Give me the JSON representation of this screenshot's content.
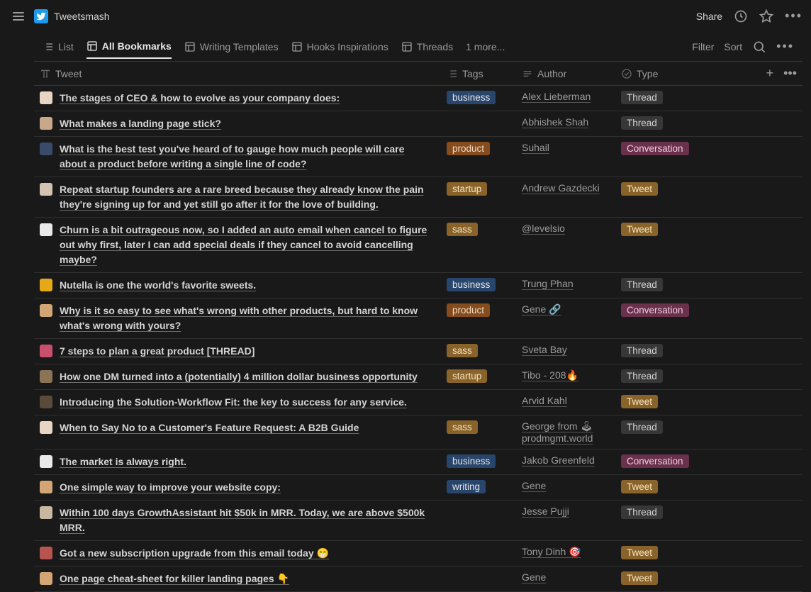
{
  "header": {
    "title": "Tweetsmash",
    "share": "Share"
  },
  "tabs": {
    "items": [
      {
        "icon": "list",
        "label": "List"
      },
      {
        "icon": "table",
        "label": "All Bookmarks",
        "active": true
      },
      {
        "icon": "table",
        "label": "Writing Templates"
      },
      {
        "icon": "table",
        "label": "Hooks Inspirations"
      },
      {
        "icon": "table",
        "label": "Threads"
      }
    ],
    "more": "1 more...",
    "filter": "Filter",
    "sort": "Sort"
  },
  "columns": {
    "tweet": "Tweet",
    "tags": "Tags",
    "author": "Author",
    "type": "Type"
  },
  "rows": [
    {
      "avatar": "#e8d5c4",
      "tweet": "The stages of CEO & how to evolve as your company does:",
      "tag": "business",
      "author": "Alex Lieberman",
      "type": "Thread"
    },
    {
      "avatar": "#c9a88a",
      "tweet": "What makes a landing page stick?",
      "tag": "",
      "author": "Abhishek Shah",
      "type": "Thread"
    },
    {
      "avatar": "#3a4a6b",
      "tweet": "What is the best test you've heard of to gauge how much people will care about a product before writing a single line of code?",
      "tag": "product",
      "author": "Suhail",
      "type": "Conversation"
    },
    {
      "avatar": "#d4c3b0",
      "tweet": "Repeat startup founders are a rare breed because they already know the pain they're signing up for and yet still go after it for the love of building.",
      "tag": "startup",
      "author": "Andrew Gazdecki",
      "type": "Tweet"
    },
    {
      "avatar": "#e8e8e8",
      "tweet": "Churn is a bit outrageous now, so I added an auto email when cancel to figure out why first, later I can add special deals if they cancel to avoid cancelling maybe?",
      "tag": "sass",
      "author": "@levelsio",
      "type": "Tweet"
    },
    {
      "avatar": "#e6a817",
      "tweet": "Nutella is one the world's favorite sweets.",
      "tag": "business",
      "author": "Trung Phan",
      "type": "Thread"
    },
    {
      "avatar": "#d4a574",
      "tweet": "Why is it so easy to see what's wrong with other products, but hard to know what's wrong with yours?",
      "tag": "product",
      "author": "Gene 🔗",
      "type": "Conversation"
    },
    {
      "avatar": "#c94f6d",
      "tweet": "7 steps to plan a great product [THREAD]",
      "tag": "sass",
      "author": "Sveta Bay",
      "type": "Thread"
    },
    {
      "avatar": "#8b7355",
      "tweet": "How one DM turned into a (potentially) 4 million dollar business opportunity",
      "tag": "startup",
      "author": "Tibo - 208🔥",
      "type": "Thread"
    },
    {
      "avatar": "#5a4a3a",
      "tweet": "Introducing the Solution-Workflow Fit: the key to success for any service.",
      "tag": "",
      "author": "Arvid Kahl",
      "type": "Tweet"
    },
    {
      "avatar": "#e8d5c4",
      "tweet": "When to Say No to a Customer's Feature Request: A B2B Guide",
      "tag": "sass",
      "author": "George from 🕹 prodmgmt.world",
      "type": "Thread"
    },
    {
      "avatar": "#e8e8e8",
      "tweet": "The market is always right.",
      "tag": "business",
      "author": "Jakob Greenfeld",
      "type": "Conversation"
    },
    {
      "avatar": "#d4a574",
      "tweet": "One simple way to improve your website copy:",
      "tag": "writing",
      "author": "Gene",
      "type": "Tweet"
    },
    {
      "avatar": "#c9b8a0",
      "tweet": "Within 100 days GrowthAssistant hit $50k in MRR. Today, we are above $500k MRR.",
      "tag": "",
      "author": "Jesse Pujji",
      "type": "Thread"
    },
    {
      "avatar": "#b85450",
      "tweet": "Got a new subscription upgrade from this email today 😁",
      "tag": "",
      "author": "Tony Dinh 🎯",
      "type": "Tweet"
    },
    {
      "avatar": "#d4a574",
      "tweet": "One page cheat-sheet for killer landing pages 👇",
      "tag": "",
      "author": "Gene",
      "type": "Tweet"
    }
  ]
}
